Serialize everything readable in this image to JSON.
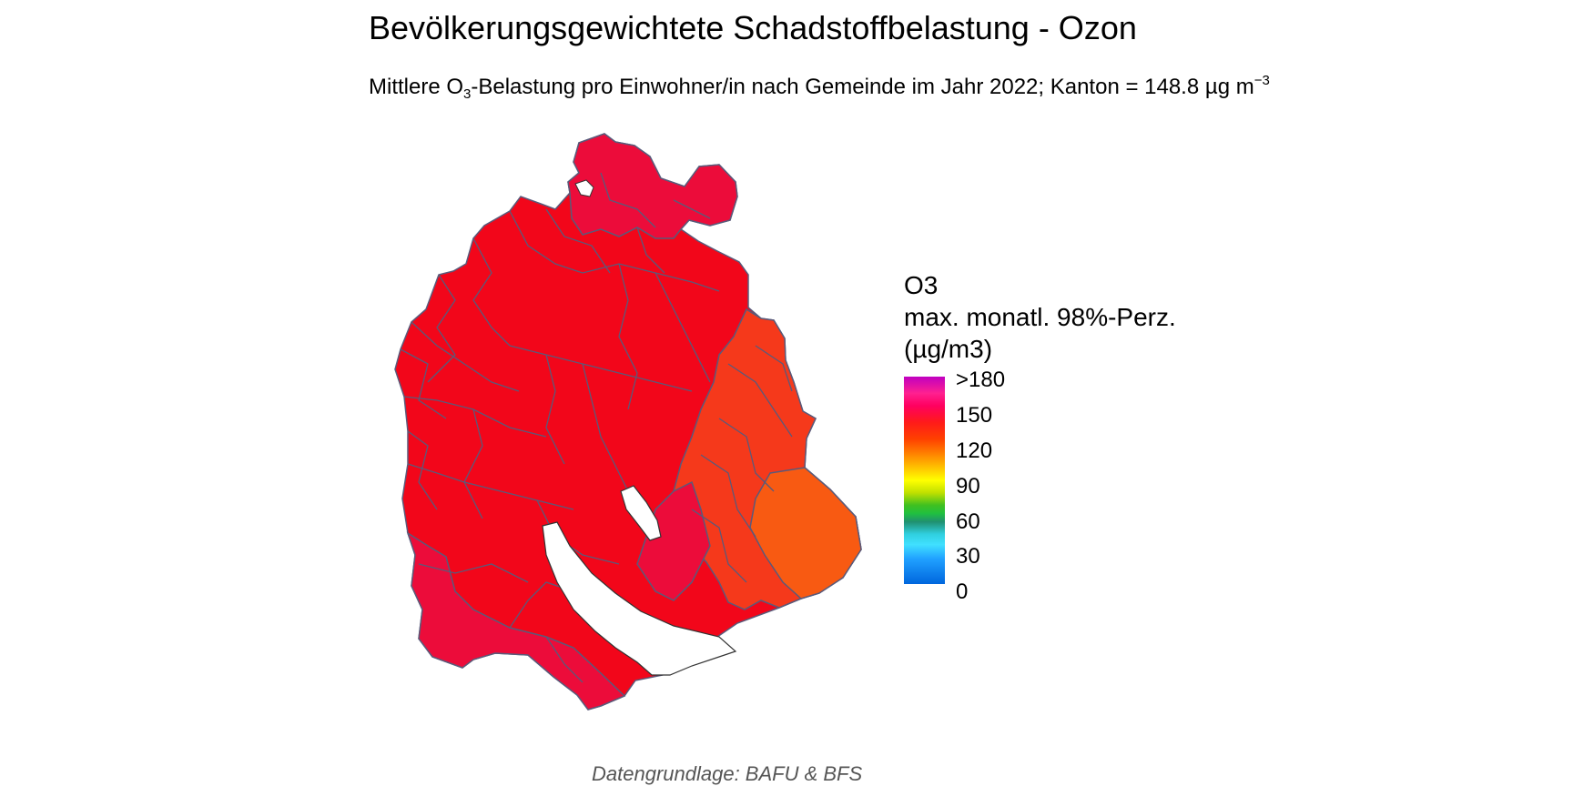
{
  "title": "Bevölkerungsgewichtete Schadstoffbelastung - Ozon",
  "subtitle": {
    "prefix": "Mittlere O",
    "sub": "3",
    "middle": "-Belastung pro Einwohner/in nach Gemeinde im Jahr 2022; Kanton = 148.8 µg m",
    "sup": "−3"
  },
  "legend": {
    "title_line1": "O3",
    "title_line2": "max. monatl. 98%-Perz.",
    "title_line3": "(µg/m3)",
    "ticks": [
      ">180",
      "150",
      "120",
      "90",
      "60",
      "30",
      "0"
    ]
  },
  "colors": {
    "region_red": "#f2061a",
    "region_crimson": "#ec0c3a",
    "region_orange_red": "#f5391b",
    "region_orange": "#f85a12",
    "border": "#5a5a7a",
    "lake_outline": "#333333"
  },
  "caption": "Datengrundlage: BAFU & BFS"
}
